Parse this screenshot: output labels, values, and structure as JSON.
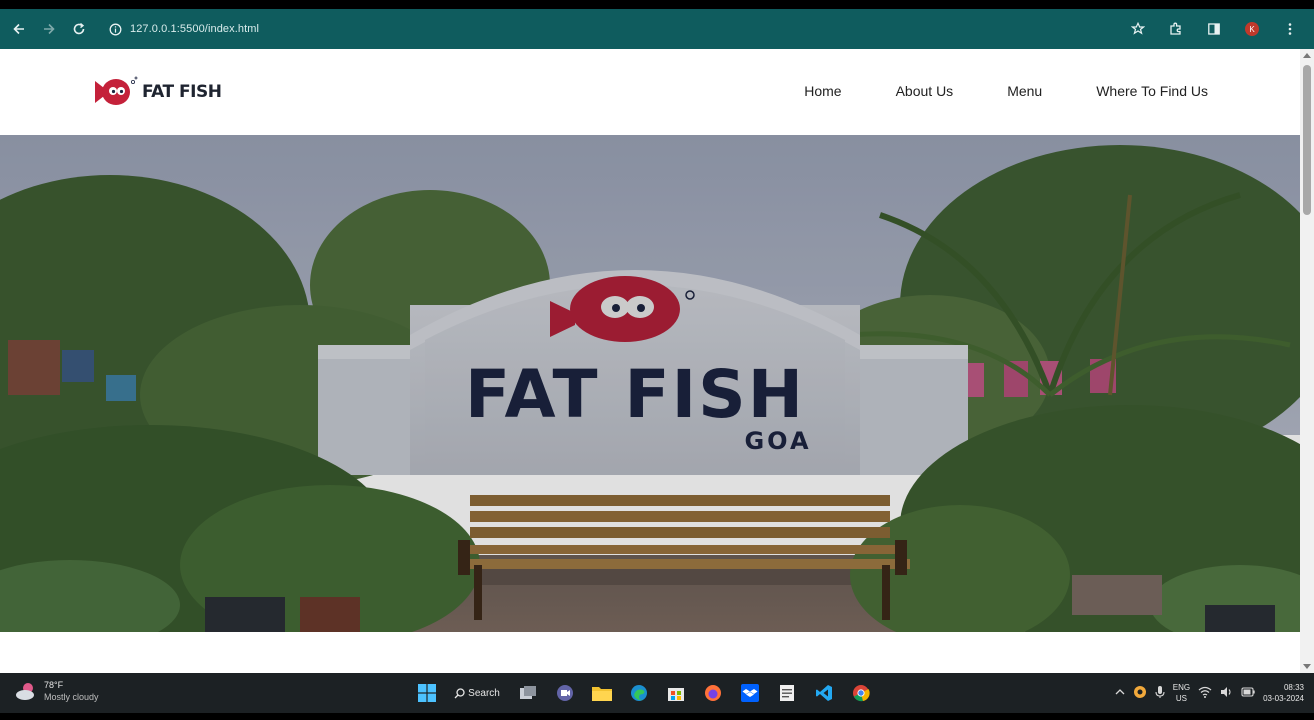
{
  "browser": {
    "url": "127.0.0.1:5500/index.html",
    "profile_initial": "K"
  },
  "site": {
    "logo_text": "FAT FISH",
    "nav": [
      {
        "label": "Home"
      },
      {
        "label": "About Us"
      },
      {
        "label": "Menu"
      },
      {
        "label": "Where To Find Us"
      }
    ],
    "hero_sign": {
      "name": "FAT FISH",
      "location": "GOA"
    }
  },
  "taskbar": {
    "weather_temp": "78°F",
    "weather_condition": "Mostly cloudy",
    "search_label": "Search",
    "lang_line1": "ENG",
    "lang_line2": "US",
    "time": "08:33",
    "date": "03-03-2024"
  },
  "colors": {
    "browser_toolbar": "#0f5c5e",
    "brand_red": "#c4213a",
    "brand_navy": "#1c2440",
    "taskbar": "#1c2124"
  }
}
